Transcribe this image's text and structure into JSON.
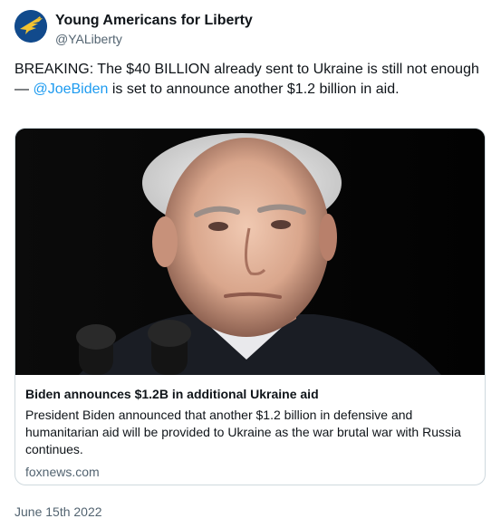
{
  "author": {
    "name": "Young Americans for Liberty",
    "handle": "@YALiberty",
    "avatar_icon": "eagle-logo-icon",
    "avatar_color": "#114a8c"
  },
  "tweet": {
    "text_before": "BREAKING: The $40 BILLION already sent to Ukraine is still not enough — ",
    "mention": "@JoeBiden",
    "text_after": " is set to announce another $1.2 billion in aid."
  },
  "card": {
    "image_description_icon": "news-photo",
    "title": "Biden announces $1.2B in additional Ukraine aid",
    "description": "President Biden announced that another $1.2 billion in defensive and humanitarian aid will be provided to Ukraine as the war brutal war with Russia continues.",
    "domain": "foxnews.com"
  },
  "timestamp": "June 15th 2022",
  "colors": {
    "link": "#1d9bf0",
    "secondary_text": "#536471",
    "border": "#cfd9de"
  }
}
